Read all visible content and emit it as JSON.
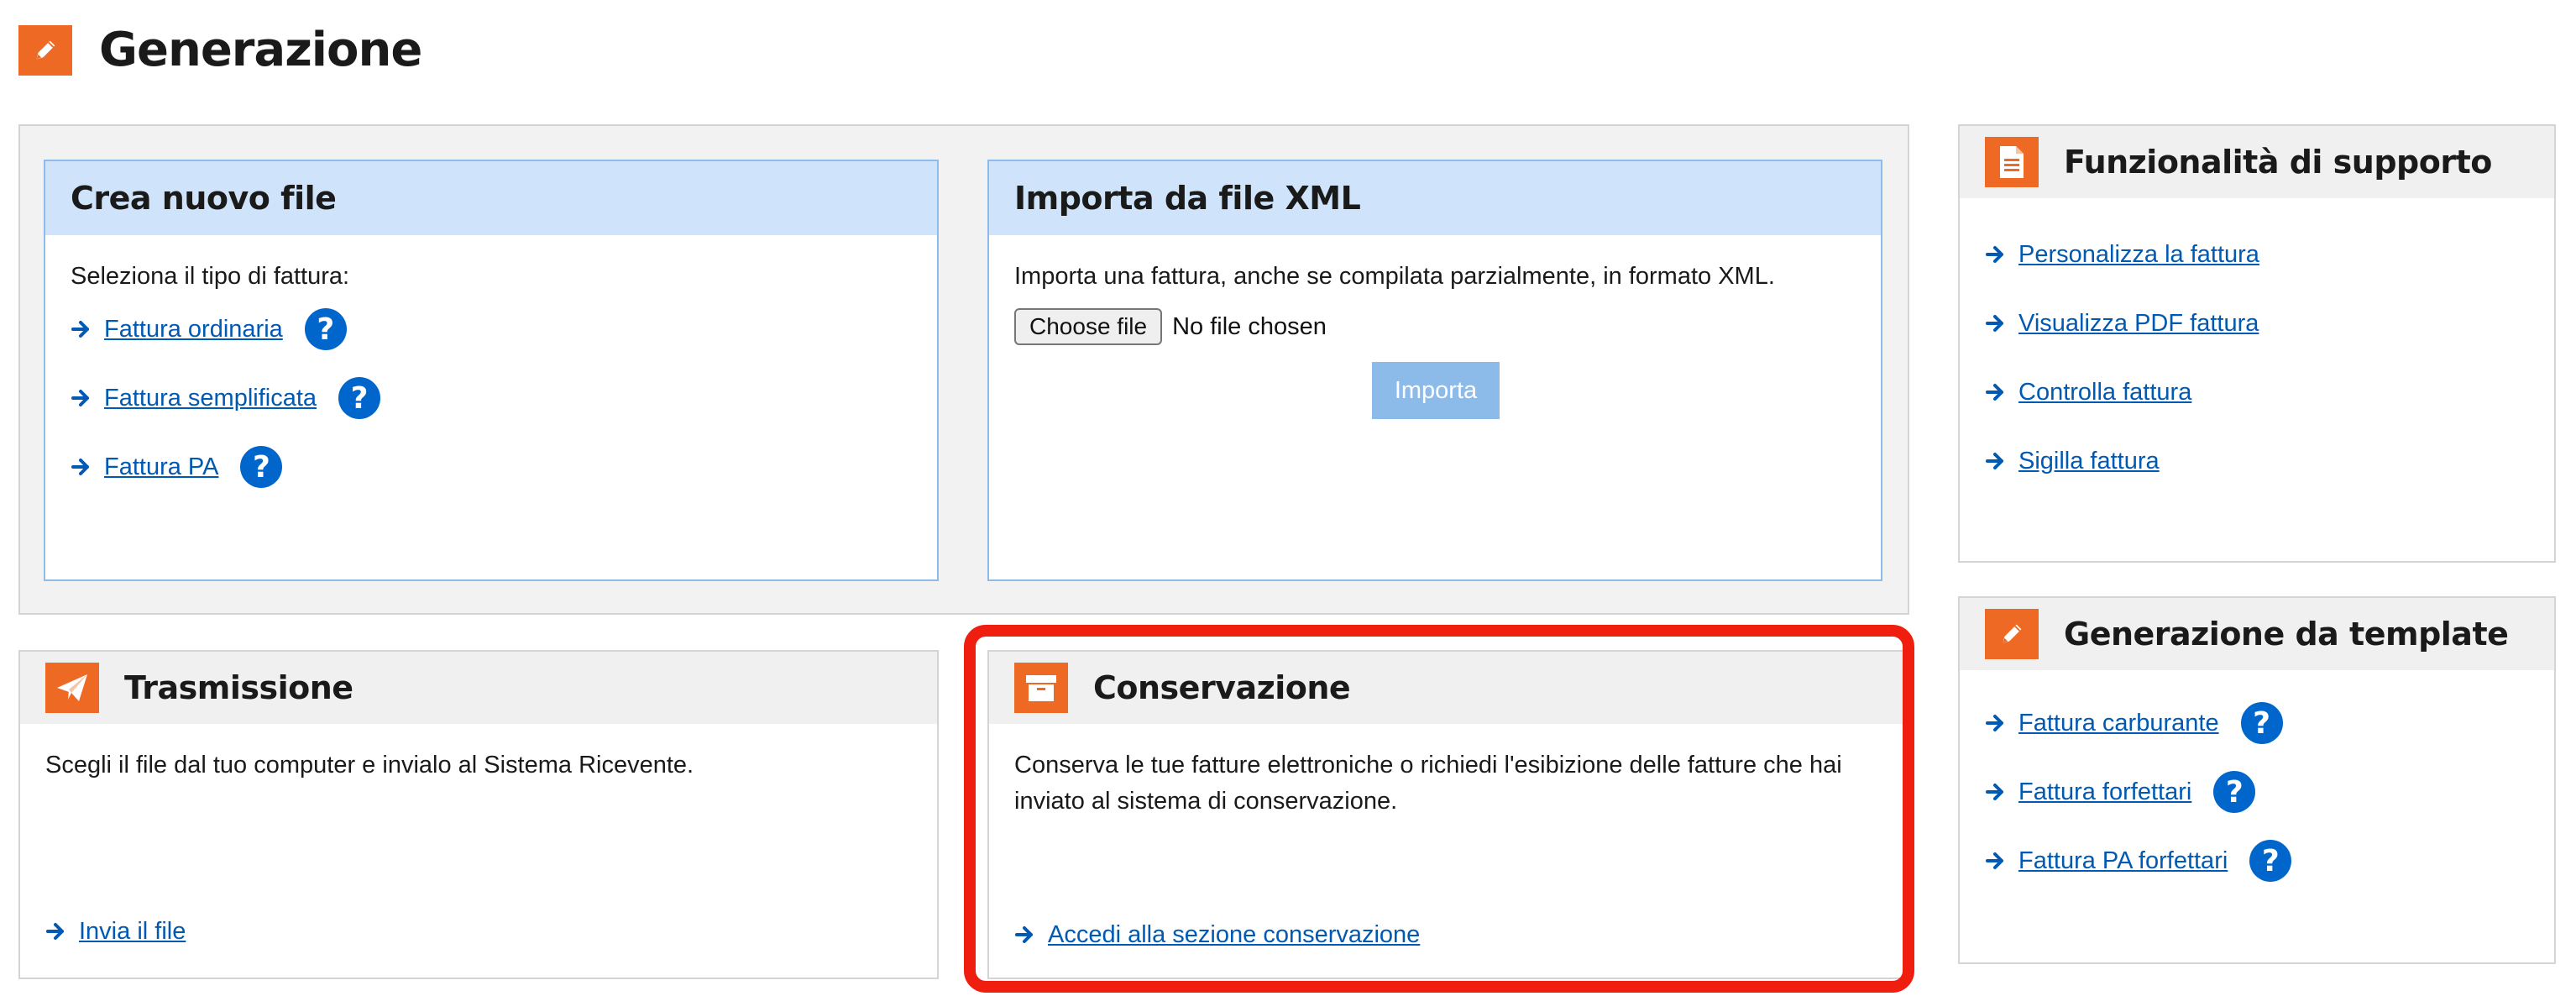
{
  "page": {
    "title": "Generazione",
    "title_icon": "pencil-icon"
  },
  "crea": {
    "title": "Crea nuovo file",
    "prompt": "Seleziona il tipo di fattura:",
    "links": [
      "Fattura ordinaria",
      "Fattura semplificata",
      "Fattura PA"
    ]
  },
  "importa": {
    "title": "Importa da file XML",
    "description": "Importa una fattura, anche se compilata parzialmente, in formato XML.",
    "choose_file_label": "Choose file",
    "file_status": "No file chosen",
    "import_label": "Importa"
  },
  "trasmissione": {
    "title": "Trasmissione",
    "icon": "paper-plane-icon",
    "description": "Scegli il file dal tuo computer e invialo al Sistema Ricevente.",
    "link": "Invia il file"
  },
  "conservazione": {
    "title": "Conservazione",
    "icon": "archive-box-icon",
    "description_line1": "Conserva le tue fatture elettroniche o richiedi l'esibizione delle fatture che hai",
    "description_line2": "inviato al sistema di conservazione.",
    "link": "Accedi alla sezione conservazione"
  },
  "supporto": {
    "title": "Funzionalità di supporto",
    "icon": "document-icon",
    "links": [
      "Personalizza la fattura",
      "Visualizza PDF fattura",
      "Controlla fattura",
      "Sigilla fattura"
    ]
  },
  "template": {
    "title": "Generazione da template",
    "icon": "pencil-icon",
    "links": [
      "Fattura carburante",
      "Fattura forfettari",
      "Fattura PA forfettari"
    ]
  },
  "colors": {
    "accent_orange": "#ee6a24",
    "link_blue": "#0059b3",
    "help_blue": "#0066cc",
    "highlight_red": "#f01e0f",
    "panel_head_blue": "#cfe3fb"
  }
}
